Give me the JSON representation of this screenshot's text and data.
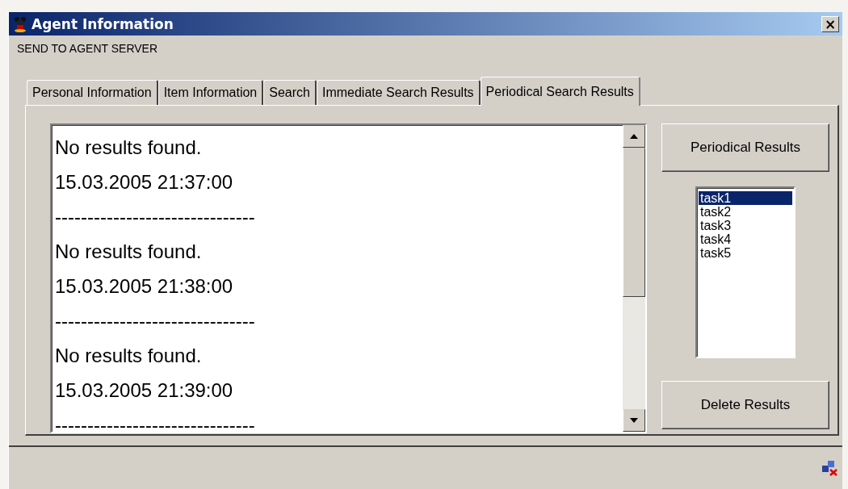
{
  "window": {
    "title": "Agent Information",
    "close": "×"
  },
  "menu": [
    "SEND TO AGENT SERVER"
  ],
  "tabs": [
    {
      "label": "Personal Information",
      "selected": false
    },
    {
      "label": "Item Information",
      "selected": false
    },
    {
      "label": "Search",
      "selected": false
    },
    {
      "label": "Immediate Search Results",
      "selected": false
    },
    {
      "label": "Periodical Search Results",
      "selected": true
    }
  ],
  "results_log": [
    "No results found.",
    "15.03.2005 21:37:00",
    "-------------------------------",
    "No results found.",
    "15.03.2005 21:38:00",
    "-------------------------------",
    "No results found.",
    "15.03.2005 21:39:00",
    "-------------------------------"
  ],
  "buttons": {
    "periodical": "Periodical Results",
    "delete": "Delete Results"
  },
  "tasks": [
    {
      "label": "task1",
      "selected": true
    },
    {
      "label": "task2",
      "selected": false
    },
    {
      "label": "task3",
      "selected": false
    },
    {
      "label": "task4",
      "selected": false
    },
    {
      "label": "task5",
      "selected": false
    }
  ]
}
